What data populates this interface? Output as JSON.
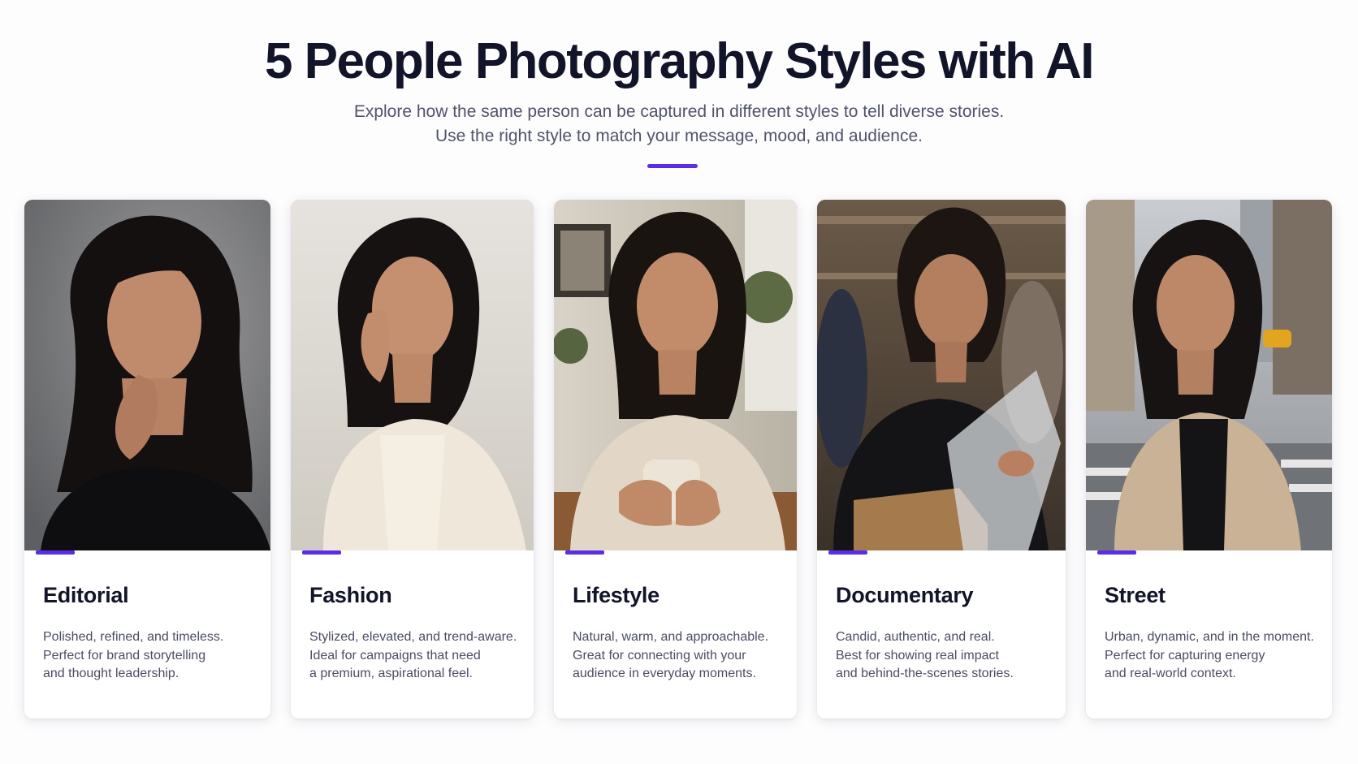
{
  "header": {
    "title": "5 People Photography Styles with AI",
    "subtitle_line1": "Explore how the same person can be captured in different styles to tell diverse stories.",
    "subtitle_line2": "Use the right style to match your message, mood, and audience."
  },
  "accent_color": "#5a2ee6",
  "cards": [
    {
      "title": "Editorial",
      "lines": [
        "Polished, refined, and timeless.",
        "Perfect for brand storytelling",
        "and thought leadership."
      ]
    },
    {
      "title": "Fashion",
      "lines": [
        "Stylized, elevated, and trend-aware.",
        "Ideal for campaigns that need",
        "a premium, aspirational feel."
      ]
    },
    {
      "title": "Lifestyle",
      "lines": [
        "Natural, warm, and approachable.",
        "Great for connecting with your",
        "audience in everyday moments."
      ]
    },
    {
      "title": "Documentary",
      "lines": [
        "Candid, authentic, and real.",
        "Best for showing real impact",
        "and behind-the-scenes stories."
      ]
    },
    {
      "title": "Street",
      "lines": [
        "Urban, dynamic, and in the moment.",
        "Perfect for capturing energy",
        "and real-world context."
      ]
    }
  ]
}
